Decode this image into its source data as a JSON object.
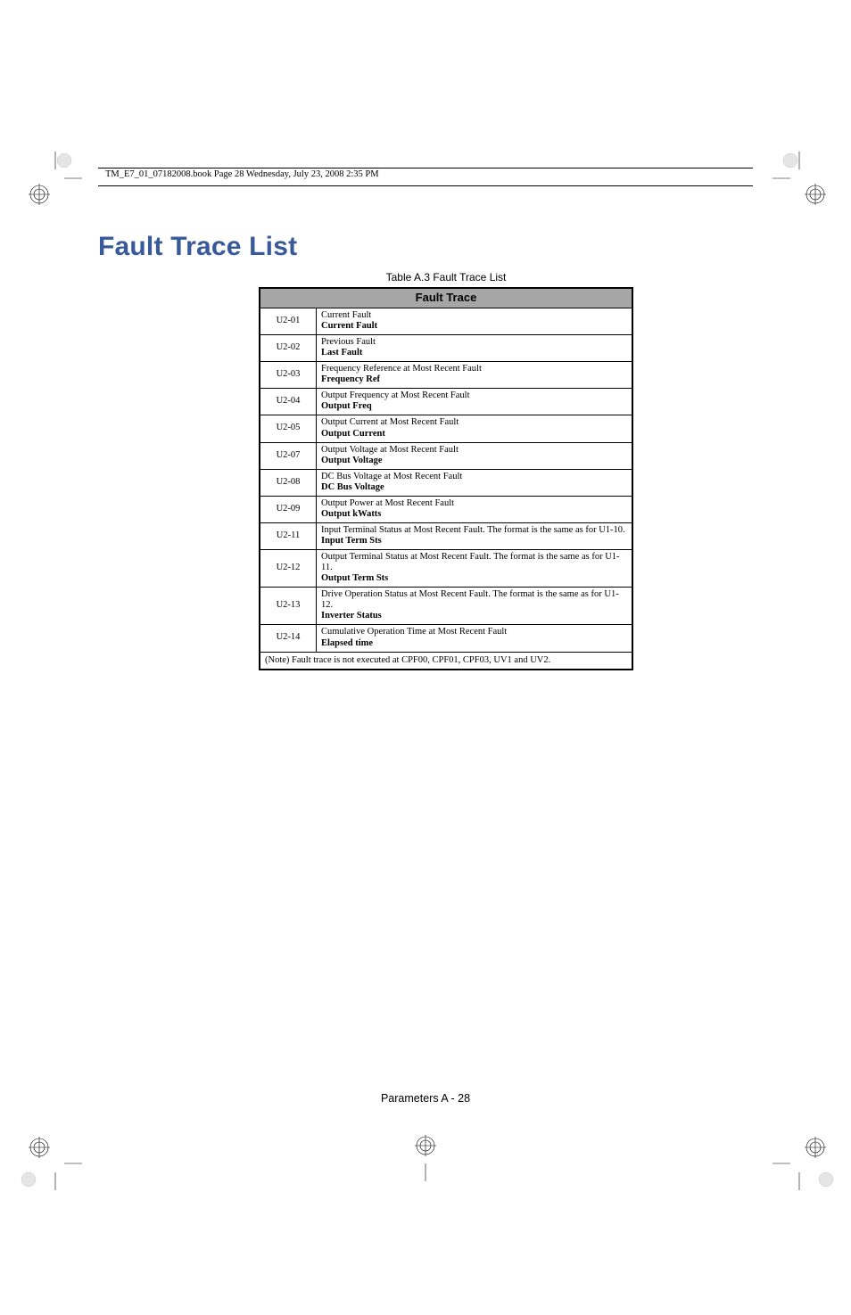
{
  "running_head": "TM_E7_01_07182008.book  Page 28  Wednesday, July 23, 2008  2:35 PM",
  "title": "Fault Trace List",
  "table_caption": "Table A.3  Fault Trace List",
  "table_header": "Fault Trace",
  "rows": [
    {
      "code": "U2-01",
      "desc": "Current Fault",
      "bold": "Current Fault"
    },
    {
      "code": "U2-02",
      "desc": "Previous Fault",
      "bold": "Last Fault"
    },
    {
      "code": "U2-03",
      "desc": "Frequency Reference at Most Recent Fault",
      "bold": "Frequency Ref"
    },
    {
      "code": "U2-04",
      "desc": "Output Frequency at Most Recent Fault",
      "bold": "Output Freq"
    },
    {
      "code": "U2-05",
      "desc": "Output Current at Most Recent Fault",
      "bold": "Output Current"
    },
    {
      "code": "U2-07",
      "desc": "Output Voltage at Most Recent Fault",
      "bold": "Output Voltage"
    },
    {
      "code": "U2-08",
      "desc": "DC Bus Voltage at Most Recent Fault",
      "bold": "DC Bus Voltage"
    },
    {
      "code": "U2-09",
      "desc": "Output Power at Most Recent Fault",
      "bold": "Output kWatts"
    },
    {
      "code": "U2-11",
      "desc": "Input Terminal Status at Most Recent Fault. The format is the same as for U1-10.",
      "bold": "Input Term Sts"
    },
    {
      "code": "U2-12",
      "desc": "Output Terminal Status at Most Recent Fault. The format is the same as for U1-11.",
      "bold": "Output Term Sts"
    },
    {
      "code": "U2-13",
      "desc": "Drive Operation Status at Most Recent Fault. The format is the same as for U1-12.",
      "bold": "Inverter Status"
    },
    {
      "code": "U2-14",
      "desc": "Cumulative Operation Time at Most Recent Fault",
      "bold": "Elapsed time"
    }
  ],
  "table_footnote": "(Note) Fault trace is not executed at CPF00, CPF01, CPF03, UV1 and UV2.",
  "footer": "Parameters  A - 28"
}
